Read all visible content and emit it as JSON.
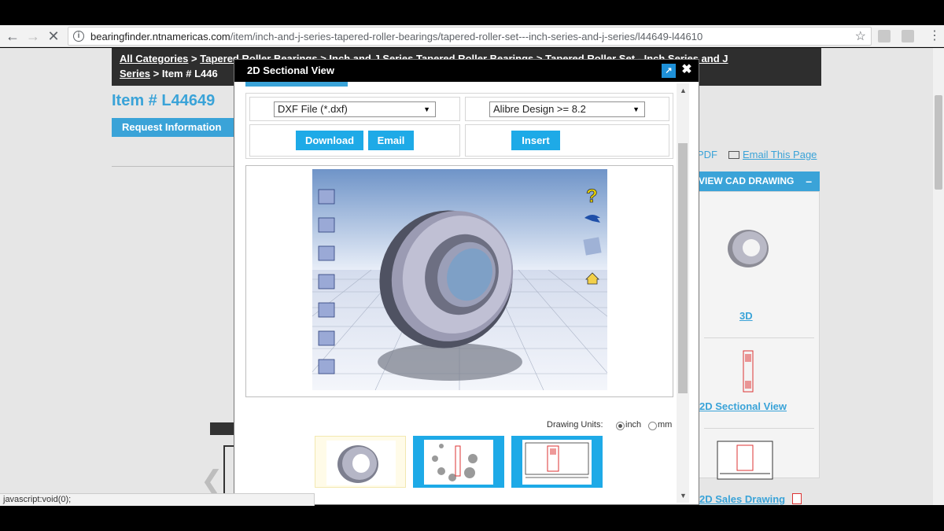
{
  "browser": {
    "url_host": "bearingfinder.ntnamericas.com",
    "url_path": "/item/inch-and-j-series-tapered-roller-bearings/tapered-roller-set---inch-series-and-j-series/l44649-l44610"
  },
  "breadcrumb": {
    "all_categories": "All Categories",
    "sep": ">",
    "tapered": "Tapered Roller Bearings",
    "inch_j": "Inch and J Series Tapered Roller Bearings",
    "set": "Tapered Roller Set - Inch Series and J",
    "series": "Series",
    "current": "Item # L446"
  },
  "item_title": "Item # L44649",
  "request_button": "Request Information",
  "pdf_link": "PDF",
  "email_link": "Email This Page",
  "cad": {
    "header": "VIEW CAD DRAWING",
    "minus": "–",
    "link_3d": "3D",
    "link_2d": "2D Sectional View",
    "link_sales": "2D Sales Drawing"
  },
  "modal": {
    "title": "2D Sectional View",
    "format_select": "DXF File (*.dxf)",
    "software_select": "Alibre Design >= 8.2",
    "download": "Download",
    "email": "Email",
    "insert": "Insert",
    "units_label": "Drawing Units:",
    "unit_inch": "inch",
    "unit_mm": "mm",
    "help_glyph": "?"
  },
  "status_bar": "javascript:void(0);",
  "colors": {
    "accent": "#1eaae7",
    "link": "#3aa3d8",
    "header_dark": "#000000"
  },
  "icons": [
    "back-arrow-icon",
    "forward-arrow-icon",
    "stop-icon",
    "info-icon",
    "star-icon",
    "close-icon",
    "popout-icon",
    "help-icon",
    "home-icon",
    "rotate-icon",
    "envelope-icon",
    "pdf-icon"
  ]
}
